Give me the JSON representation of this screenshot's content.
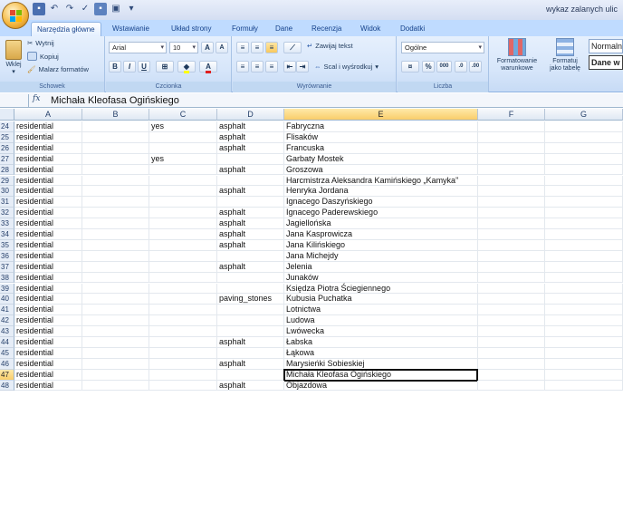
{
  "window": {
    "title": "wykaz zalanych ulic"
  },
  "quick_access": {
    "items": [
      "save-icon",
      "undo-icon",
      "redo-icon",
      "spell-icon",
      "print-icon",
      "preview-icon",
      "more-icon"
    ]
  },
  "tabs": [
    "Narzędzia główne",
    "Wstawianie",
    "Układ strony",
    "Formuły",
    "Dane",
    "Recenzja",
    "Widok",
    "Dodatki"
  ],
  "ribbon": {
    "clipboard": {
      "paste": "Wklej",
      "cut": "Wytnij",
      "copy": "Kopiuj",
      "format_painter": "Malarz formatów",
      "label": "Schowek"
    },
    "font": {
      "name": "Arial",
      "size": "10",
      "bold": "B",
      "italic": "I",
      "underline": "U",
      "label": "Czcionka"
    },
    "alignment": {
      "wrap": "Zawijaj tekst",
      "merge": "Scal i wyśrodkuj",
      "label": "Wyrównanie"
    },
    "number": {
      "format": "Ogólne",
      "percent": "%",
      "thousands": "000",
      "label": "Liczba"
    },
    "styles": {
      "conditional_line1": "Formatowanie",
      "conditional_line2": "warunkowe",
      "table_line1": "Formatuj",
      "table_line2": "jako tabelę",
      "normal": "Normaln",
      "data_input": "Dane w"
    }
  },
  "formula_bar": {
    "fx": "fx",
    "value": "Michała Kleofasa Ogińskiego"
  },
  "columns": [
    "A",
    "B",
    "C",
    "D",
    "E",
    "F",
    "G"
  ],
  "selected_column": "E",
  "selected_row": "47",
  "rows": [
    {
      "n": "24",
      "a": "residential",
      "c": "yes",
      "d": "asphalt",
      "e": "Fabryczna"
    },
    {
      "n": "25",
      "a": "residential",
      "c": "",
      "d": "asphalt",
      "e": "Flisaków"
    },
    {
      "n": "26",
      "a": "residential",
      "c": "",
      "d": "asphalt",
      "e": "Francuska"
    },
    {
      "n": "27",
      "a": "residential",
      "c": "yes",
      "d": "",
      "e": "Garbaty Mostek"
    },
    {
      "n": "28",
      "a": "residential",
      "c": "",
      "d": "asphalt",
      "e": "Groszowa"
    },
    {
      "n": "29",
      "a": "residential",
      "c": "",
      "d": "",
      "e": "Harcmistrza Aleksandra Kamińskiego „Kamyka”"
    },
    {
      "n": "30",
      "a": "residential",
      "c": "",
      "d": "asphalt",
      "e": "Henryka Jordana"
    },
    {
      "n": "31",
      "a": "residential",
      "c": "",
      "d": "",
      "e": "Ignacego Daszyńskiego"
    },
    {
      "n": "32",
      "a": "residential",
      "c": "",
      "d": "asphalt",
      "e": "Ignacego Paderewskiego"
    },
    {
      "n": "33",
      "a": "residential",
      "c": "",
      "d": "asphalt",
      "e": "Jagiellońska"
    },
    {
      "n": "34",
      "a": "residential",
      "c": "",
      "d": "asphalt",
      "e": "Jana Kasprowicza"
    },
    {
      "n": "35",
      "a": "residential",
      "c": "",
      "d": "asphalt",
      "e": "Jana Kilińskiego"
    },
    {
      "n": "36",
      "a": "residential",
      "c": "",
      "d": "",
      "e": "Jana Michejdy"
    },
    {
      "n": "37",
      "a": "residential",
      "c": "",
      "d": "asphalt",
      "e": "Jelenia"
    },
    {
      "n": "38",
      "a": "residential",
      "c": "",
      "d": "",
      "e": "Junaków"
    },
    {
      "n": "39",
      "a": "residential",
      "c": "",
      "d": "",
      "e": "Księdza Piotra Ściegiennego"
    },
    {
      "n": "40",
      "a": "residential",
      "c": "",
      "d": "paving_stones",
      "e": "Kubusia Puchatka"
    },
    {
      "n": "41",
      "a": "residential",
      "c": "",
      "d": "",
      "e": "Lotnictwa"
    },
    {
      "n": "42",
      "a": "residential",
      "c": "",
      "d": "",
      "e": "Ludowa"
    },
    {
      "n": "43",
      "a": "residential",
      "c": "",
      "d": "",
      "e": "Lwówecka"
    },
    {
      "n": "44",
      "a": "residential",
      "c": "",
      "d": "asphalt",
      "e": "Łabska"
    },
    {
      "n": "45",
      "a": "residential",
      "c": "",
      "d": "",
      "e": "Łąkowa"
    },
    {
      "n": "46",
      "a": "residential",
      "c": "",
      "d": "asphalt",
      "e": "Marysieńki Sobieskiej"
    },
    {
      "n": "47",
      "a": "residential",
      "c": "",
      "d": "",
      "e": "Michała Kleofasa Ogińskiego"
    },
    {
      "n": "48",
      "a": "residential",
      "c": "",
      "d": "asphalt",
      "e": "Objazdowa"
    }
  ],
  "colors": {
    "ribbon_bg": "#d7e6fa",
    "tab_text": "#15428b",
    "selection": "#f9cd6a"
  }
}
